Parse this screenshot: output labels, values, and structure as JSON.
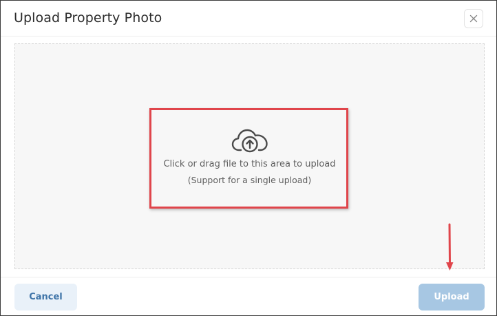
{
  "dialog": {
    "title": "Upload Property Photo",
    "close_icon": "close-icon"
  },
  "dropzone": {
    "icon": "cloud-upload-icon",
    "primary_text": "Click or drag file to this area to upload",
    "secondary_text": "(Support for a single upload)"
  },
  "footer": {
    "cancel_label": "Cancel",
    "upload_label": "Upload"
  },
  "annotations": {
    "highlight_color": "#e0454b",
    "arrow_color": "#e0454b"
  },
  "colors": {
    "primary_button_disabled": "#a7c7e3",
    "secondary_button_bg": "#e9f1f9",
    "secondary_button_text": "#3f74a8"
  }
}
